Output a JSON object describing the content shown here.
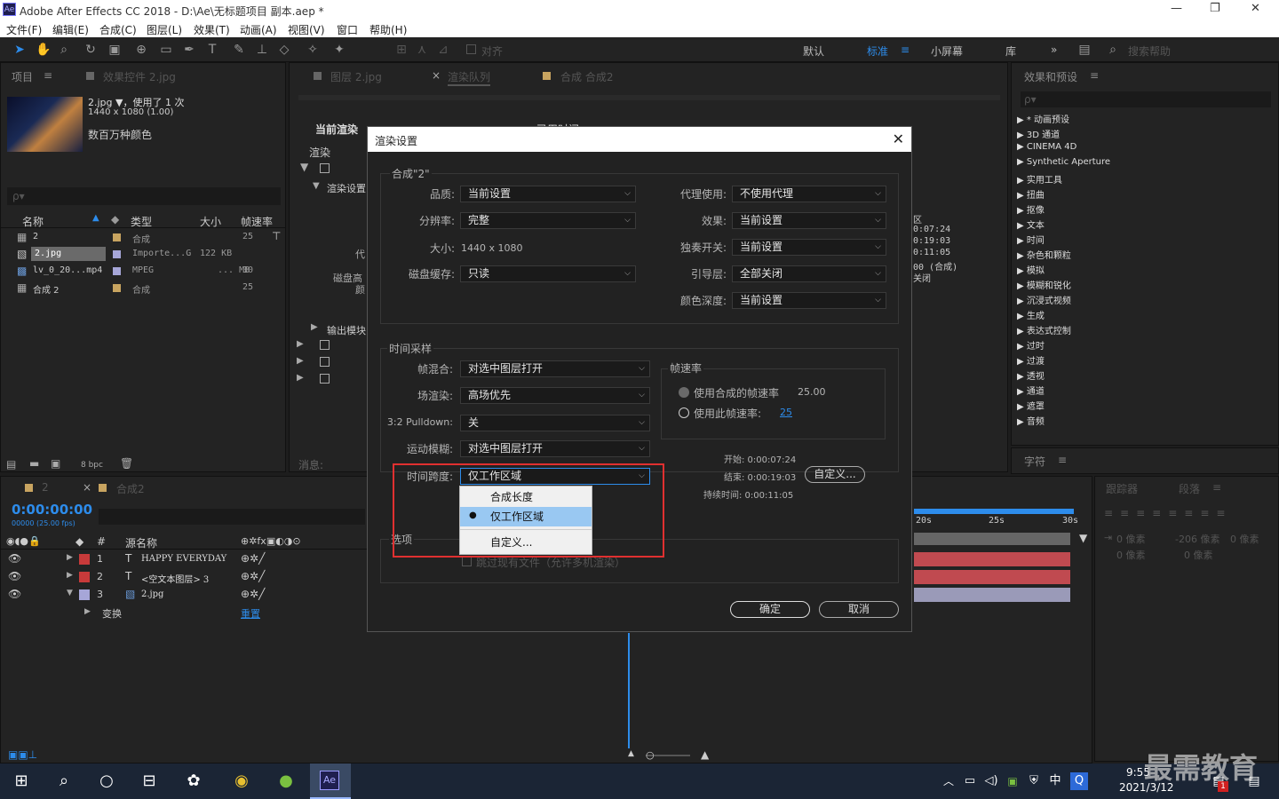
{
  "app": {
    "title": "Adobe After Effects CC 2018 - D:\\Ae\\无标题项目 副本.aep *",
    "logo": "Ae"
  },
  "window": {
    "minimize": "—",
    "restore": "❐",
    "close": "✕"
  },
  "menu": [
    "文件(F)",
    "编辑(E)",
    "合成(C)",
    "图层(L)",
    "效果(T)",
    "动画(A)",
    "视图(V)",
    "窗口",
    "帮助(H)"
  ],
  "toolbar": {
    "align": "对齐",
    "workspaces": [
      "默认",
      "标准",
      "小屏幕",
      "库"
    ],
    "active_ws": "标准",
    "more": "»",
    "search_placeholder": "搜索帮助"
  },
  "project": {
    "tab": "项目",
    "tab_menu": "≡",
    "effects_tab": "效果控件 2.jpg",
    "item_name": "2.jpg ▼，使用了 1 次",
    "item_dims": "1440 x 1080 (1.00)",
    "item_color": "数百万种颜色",
    "search": "ρ▾",
    "headers": {
      "name": "名称",
      "type": "类型",
      "size": "大小",
      "fps": "帧速率"
    },
    "rows": [
      {
        "name": "2",
        "type": "合成",
        "size": "",
        "fps": "25"
      },
      {
        "name": "2.jpg",
        "type": "Importe...G",
        "size": "122 KB",
        "fps": ""
      },
      {
        "name": "lv_0_20...mp4",
        "type": "MPEG",
        "size": "... MB",
        "fps": "30"
      },
      {
        "name": "合成 2",
        "type": "合成",
        "size": "",
        "fps": "25"
      }
    ],
    "bpc": "8 bpc"
  },
  "center": {
    "tabs": [
      "图层 2.jpg",
      "渲染队列",
      "合成 合成2"
    ],
    "current_render": "当前渲染",
    "elapsed": "已用时间：",
    "queue_header": "渲染",
    "render_settings": "渲染设置",
    "output_module": "输出模块",
    "message": "消息:",
    "proxy_hint": "代",
    "disk_hint": "磁盘高",
    "color_hint": "颜",
    "side_vals": [
      "区",
      "0:07:24",
      "0:19:03",
      "0:11:05",
      "00 (合成)",
      "关闭"
    ]
  },
  "effects": {
    "tab": "效果和预设",
    "search": "ρ▾",
    "items": [
      "* 动画预设",
      "3D 通道",
      "CINEMA 4D",
      "Synthetic Aperture",
      "实用工具",
      "扭曲",
      "抠像",
      "文本",
      "时间",
      "杂色和颗粒",
      "模拟",
      "模糊和锐化",
      "沉浸式视频",
      "生成",
      "表达式控制",
      "过时",
      "过渡",
      "透视",
      "通道",
      "遮罩",
      "音频"
    ],
    "char_tab": "字符",
    "tracker_tab": "跟踪器",
    "para_tab": "段落",
    "para_vals": [
      "0 像素",
      "-206 像素",
      "0 像素",
      "0 像素",
      "0 像素"
    ]
  },
  "timeline": {
    "tabs": [
      "2",
      "合成2"
    ],
    "timecode": "0:00:00:00",
    "fps_info": "00000 (25.00 fps)",
    "col_source": "源名称",
    "layers": [
      {
        "num": "1",
        "type": "T",
        "name": "HAPPY EVERYDAY"
      },
      {
        "num": "2",
        "type": "T",
        "name": "<空文本图层> 3"
      },
      {
        "num": "3",
        "type": "img",
        "name": "2.jpg"
      }
    ],
    "transform": "变换",
    "reset": "重置",
    "ruler": [
      "20s",
      "25s",
      "30s"
    ]
  },
  "dialog": {
    "title": "渲染设置",
    "close": "✕",
    "comp_group": "合成\"2\"",
    "quality": {
      "label": "品质:",
      "value": "当前设置"
    },
    "resolution": {
      "label": "分辨率:",
      "value": "完整"
    },
    "size": {
      "label": "大小:",
      "value": "1440 x 1080"
    },
    "disk_cache": {
      "label": "磁盘缓存:",
      "value": "只读"
    },
    "proxy": {
      "label": "代理使用:",
      "value": "不使用代理"
    },
    "effects": {
      "label": "效果:",
      "value": "当前设置"
    },
    "solo": {
      "label": "独奏开关:",
      "value": "当前设置"
    },
    "guide": {
      "label": "引导层:",
      "value": "全部关闭"
    },
    "color_depth": {
      "label": "颜色深度:",
      "value": "当前设置"
    },
    "time_group": "时间采样",
    "frame_blend": {
      "label": "帧混合:",
      "value": "对选中图层打开"
    },
    "field_render": {
      "label": "场渲染:",
      "value": "高场优先"
    },
    "pulldown": {
      "label": "3:2 Pulldown:",
      "value": "关"
    },
    "motion_blur": {
      "label": "运动模糊:",
      "value": "对选中图层打开"
    },
    "time_span": {
      "label": "时间跨度:",
      "value": "仅工作区域"
    },
    "fps_group": "帧速率",
    "fps_comp": {
      "label": "使用合成的帧速率",
      "value": "25.00"
    },
    "fps_this": {
      "label": "使用此帧速率:",
      "value": "25"
    },
    "start": "开始: 0:00:07:24",
    "end": "结束: 0:00:19:03",
    "duration": "持续时间: 0:00:11:05",
    "custom_btn": "自定义...",
    "options_group": "选项",
    "skip": "跳过现有文件（允许多机渲染）",
    "ok": "确定",
    "cancel": "取消",
    "dropdown": [
      "合成长度",
      "仅工作区域",
      "自定义..."
    ]
  },
  "taskbar": {
    "time": "9:55",
    "date": "2021/3/12",
    "ime": "中",
    "watermark": "最需教育",
    "badge": "1"
  }
}
